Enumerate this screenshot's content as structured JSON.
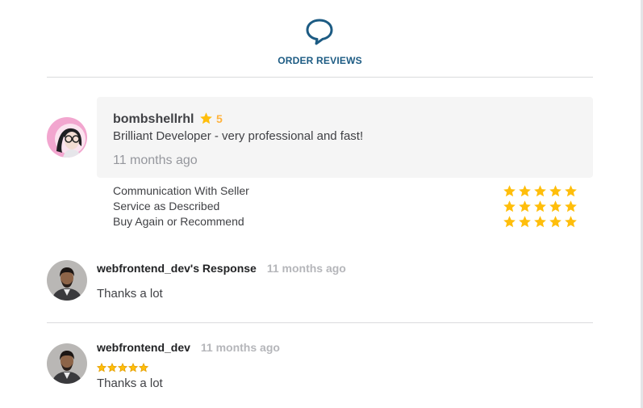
{
  "colors": {
    "accent": "#1c5b83",
    "star": "#ffbe0b",
    "rating_text": "#ffb33e",
    "muted": "#95979d"
  },
  "header": {
    "icon": "chat-bubble-icon",
    "title": "ORDER REVIEWS"
  },
  "review": {
    "buyer_name": "bombshellrhl",
    "rating": "5",
    "text": "Brilliant Developer - very professional and fast!",
    "time": "11 months ago",
    "breakdown": [
      {
        "label": "Communication With Seller",
        "stars": 5
      },
      {
        "label": "Service as Described",
        "stars": 5
      },
      {
        "label": "Buy Again or Recommend",
        "stars": 5
      }
    ]
  },
  "response": {
    "title": "webfrontend_dev's Response",
    "time": "11 months ago",
    "text": "Thanks a lot"
  },
  "seller_review": {
    "name": "webfrontend_dev",
    "time": "11 months ago",
    "stars": 5,
    "text": "Thanks a lot"
  }
}
